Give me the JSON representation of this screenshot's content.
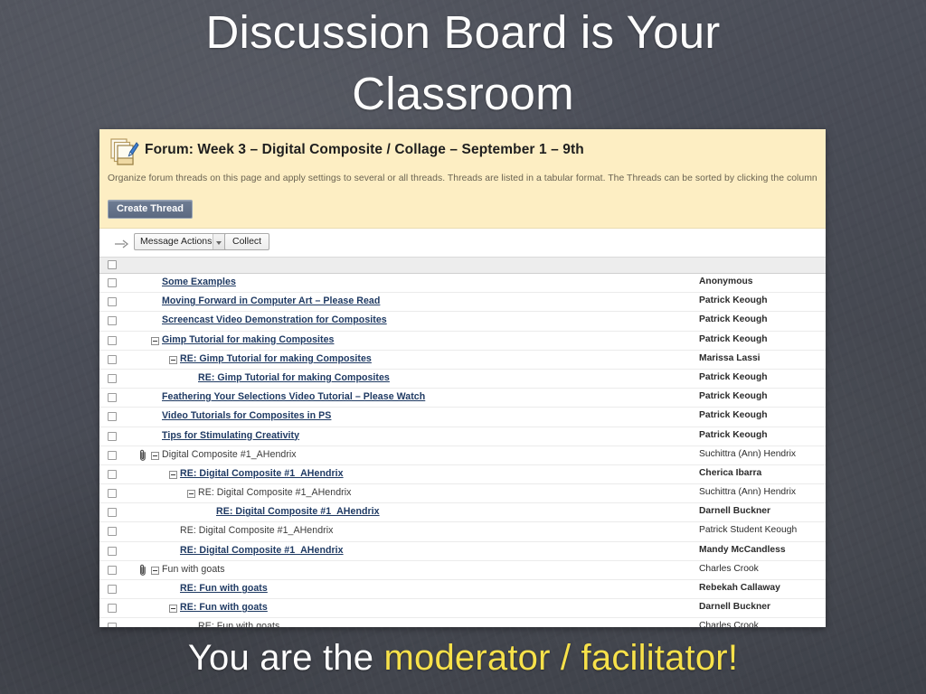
{
  "slide": {
    "headline_line1": "Discussion Board is Your",
    "headline_line2": "Classroom",
    "caption_plain": "You are the ",
    "caption_highlight": "moderator / facilitator!",
    "background_color": "#4a4d57",
    "highlight_color": "#f7e14a"
  },
  "forum": {
    "title": "Forum: Week 3 – Digital Composite / Collage – September 1 – 9th",
    "description": "Organize forum threads on this page and apply settings to several or all threads. Threads are listed in a tabular format. The Threads can be sorted by clicking the column",
    "create_thread_label": "Create Thread",
    "toolbar": {
      "message_actions_label": "Message Actions",
      "collect_label": "Collect"
    },
    "threads": [
      {
        "subject": "Some Examples",
        "author": "Anonymous",
        "indent": 0,
        "unread": true,
        "author_unread": true,
        "attachment": false,
        "twisty": false
      },
      {
        "subject": "Moving Forward in Computer Art – Please Read",
        "author": "Patrick Keough",
        "indent": 0,
        "unread": true,
        "author_unread": true,
        "attachment": false,
        "twisty": false
      },
      {
        "subject": "Screencast Video Demonstration for Composites",
        "author": "Patrick Keough",
        "indent": 0,
        "unread": true,
        "author_unread": true,
        "attachment": false,
        "twisty": false
      },
      {
        "subject": "Gimp Tutorial for making Composites",
        "author": "Patrick Keough",
        "indent": 0,
        "unread": true,
        "author_unread": true,
        "attachment": false,
        "twisty": true
      },
      {
        "subject": "RE: Gimp Tutorial for making Composites",
        "author": "Marissa Lassi",
        "indent": 1,
        "unread": true,
        "author_unread": true,
        "attachment": false,
        "twisty": true
      },
      {
        "subject": "RE: Gimp Tutorial for making Composites",
        "author": "Patrick Keough",
        "indent": 2,
        "unread": true,
        "author_unread": true,
        "attachment": false,
        "twisty": false
      },
      {
        "subject": "Feathering Your Selections Video Tutorial – Please Watch",
        "author": "Patrick Keough",
        "indent": 0,
        "unread": true,
        "author_unread": true,
        "attachment": false,
        "twisty": false
      },
      {
        "subject": "Video Tutorials for Composites in PS",
        "author": "Patrick Keough",
        "indent": 0,
        "unread": true,
        "author_unread": true,
        "attachment": false,
        "twisty": false
      },
      {
        "subject": "Tips for Stimulating Creativity",
        "author": "Patrick Keough",
        "indent": 0,
        "unread": true,
        "author_unread": true,
        "attachment": false,
        "twisty": false
      },
      {
        "subject": "Digital Composite #1_AHendrix",
        "author": "Suchittra (Ann) Hendrix",
        "indent": 0,
        "unread": false,
        "author_unread": false,
        "attachment": true,
        "twisty": true
      },
      {
        "subject": "RE: Digital Composite #1_AHendrix",
        "author": "Cherica Ibarra",
        "indent": 1,
        "unread": true,
        "author_unread": true,
        "attachment": false,
        "twisty": true
      },
      {
        "subject": "RE: Digital Composite #1_AHendrix",
        "author": "Suchittra (Ann) Hendrix",
        "indent": 2,
        "unread": false,
        "author_unread": false,
        "attachment": false,
        "twisty": true
      },
      {
        "subject": "RE: Digital Composite #1_AHendrix",
        "author": "Darnell Buckner",
        "indent": 3,
        "unread": true,
        "author_unread": true,
        "attachment": false,
        "twisty": false
      },
      {
        "subject": "RE: Digital Composite #1_AHendrix",
        "author": "Patrick Student Keough",
        "indent": 1,
        "unread": false,
        "author_unread": false,
        "attachment": false,
        "twisty": false
      },
      {
        "subject": "RE: Digital Composite #1_AHendrix",
        "author": "Mandy McCandless",
        "indent": 1,
        "unread": true,
        "author_unread": true,
        "attachment": false,
        "twisty": false
      },
      {
        "subject": "Fun with goats",
        "author": "Charles Crook",
        "indent": 0,
        "unread": false,
        "author_unread": false,
        "attachment": true,
        "twisty": true
      },
      {
        "subject": "RE: Fun with goats",
        "author": "Rebekah Callaway",
        "indent": 1,
        "unread": true,
        "author_unread": true,
        "attachment": false,
        "twisty": false
      },
      {
        "subject": "RE: Fun with goats",
        "author": "Darnell Buckner",
        "indent": 1,
        "unread": true,
        "author_unread": true,
        "attachment": false,
        "twisty": true
      },
      {
        "subject": "RE: Fun with goats",
        "author": "Charles Crook",
        "indent": 2,
        "unread": false,
        "author_unread": false,
        "attachment": false,
        "twisty": false
      }
    ]
  }
}
